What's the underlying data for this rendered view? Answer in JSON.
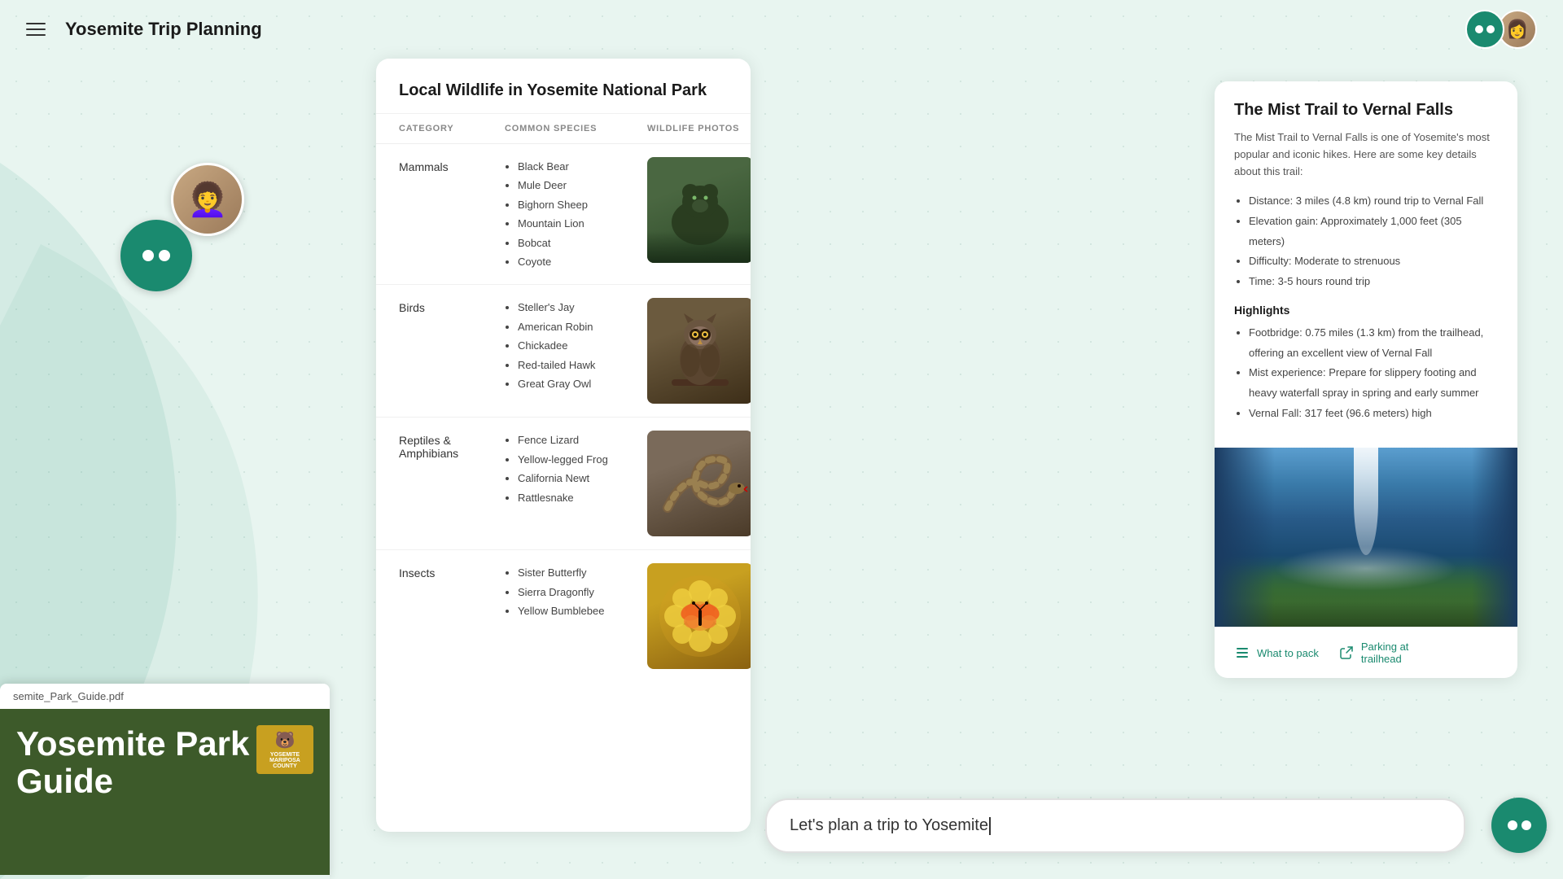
{
  "app": {
    "title": "Yosemite Trip Planning"
  },
  "header": {
    "menu_label": "Menu",
    "title": "Yosemite Trip Planning"
  },
  "wildlife_table": {
    "title": "Local Wildlife in Yosemite National Park",
    "columns": [
      "CATEGORY",
      "COMMON SPECIES",
      "WILDLIFE PHOTOS"
    ],
    "rows": [
      {
        "category": "Mammals",
        "species": [
          "Black Bear",
          "Mule Deer",
          "Bighorn Sheep",
          "Mountain Lion",
          "Bobcat",
          "Coyote"
        ],
        "photo_type": "bear"
      },
      {
        "category": "Birds",
        "species": [
          "Steller's Jay",
          "American Robin",
          "Chickadee",
          "Red-tailed Hawk",
          "Great Gray Owl"
        ],
        "photo_type": "owl"
      },
      {
        "category": "Reptiles & Amphibians",
        "species": [
          "Fence Lizard",
          "Yellow-legged Frog",
          "California Newt",
          "Rattlesnake"
        ],
        "photo_type": "snake"
      },
      {
        "category": "Insects",
        "species": [
          "Sister Butterfly",
          "Sierra Dragonfly",
          "Yellow Bumblebee"
        ],
        "photo_type": "butterfly"
      }
    ]
  },
  "trail_card": {
    "title": "The Mist Trail to Vernal Falls",
    "description": "The Mist Trail to Vernal Falls is one of Yosemite's most popular and iconic hikes. Here are some key details about this trail:",
    "details": [
      "Distance: 3 miles (4.8 km) round trip to Vernal Fall",
      "Elevation gain: Approximately 1,000 feet (305 meters)",
      "Difficulty: Moderate to strenuous",
      "Time: 3-5 hours round trip"
    ],
    "highlights_title": "Highlights",
    "highlights": [
      "Footbridge: 0.75 miles (1.3 km) from the trailhead, offering an excellent view of Vernal Fall",
      "Mist experience: Prepare for slippery footing and heavy waterfall spray in spring and early summer",
      "Vernal Fall: 317 feet (96.6 meters) high"
    ],
    "footer_links": [
      {
        "icon": "list-icon",
        "label": "What to pack"
      },
      {
        "icon": "link-icon",
        "label": "Parking at trailhead"
      }
    ]
  },
  "pdf": {
    "filename": "semite_Park_Guide.pdf",
    "title": "Yosemite Park Guide",
    "logo_text": "YOSEMITE\nMARIPOSA\nCOUNTY"
  },
  "chat": {
    "input_text": "Let's plan a trip to Yosemite",
    "input_placeholder": "Let's plan a trip to Yosemite"
  }
}
